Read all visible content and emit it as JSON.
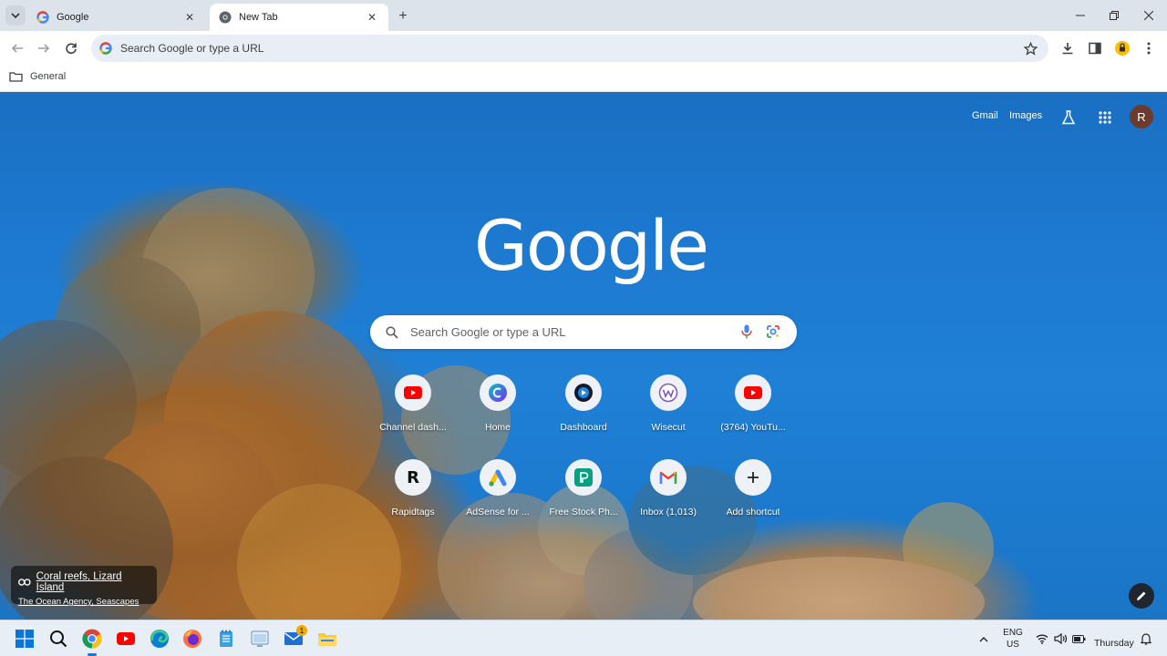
{
  "tabs": [
    {
      "title": "Google",
      "favicon": "google-g-icon",
      "active": false
    },
    {
      "title": "New Tab",
      "favicon": "chrome-icon",
      "active": true
    }
  ],
  "omnibox": {
    "placeholder": "Search Google or type a URL"
  },
  "bookmarks": [
    {
      "label": "General",
      "icon": "folder-icon"
    }
  ],
  "ntp": {
    "top_links": {
      "gmail": "Gmail",
      "images": "Images"
    },
    "avatar_letter": "R",
    "logo_text": "Google",
    "search_placeholder": "Search Google or type a URL",
    "shortcuts": [
      {
        "label": "Channel dash...",
        "icon": "youtube-icon"
      },
      {
        "label": "Home",
        "icon": "canva-icon"
      },
      {
        "label": "Dashboard",
        "icon": "dashboard-app-icon"
      },
      {
        "label": "Wisecut",
        "icon": "wisecut-icon"
      },
      {
        "label": "(3764) YouTu...",
        "icon": "youtube-icon"
      },
      {
        "label": "Rapidtags",
        "icon": "rapidtags-icon"
      },
      {
        "label": "AdSense for ...",
        "icon": "adsense-icon"
      },
      {
        "label": "Free Stock Ph...",
        "icon": "pexels-icon"
      },
      {
        "label": "Inbox (1,013)",
        "icon": "gmail-icon"
      },
      {
        "label": "Add shortcut",
        "icon": "plus-icon"
      }
    ],
    "attribution": {
      "title": "Coral reefs, Lizard Island",
      "subtitle": "The Ocean Agency, Seascapes"
    }
  },
  "taskbar": {
    "mail_badge": "1",
    "lang_line1": "ENG",
    "lang_line2": "US",
    "day": "Thursday"
  },
  "colors": {
    "accent": "#1a73e8",
    "ntp_blue": "#1f80d6",
    "tabstrip": "#dde3ea"
  }
}
